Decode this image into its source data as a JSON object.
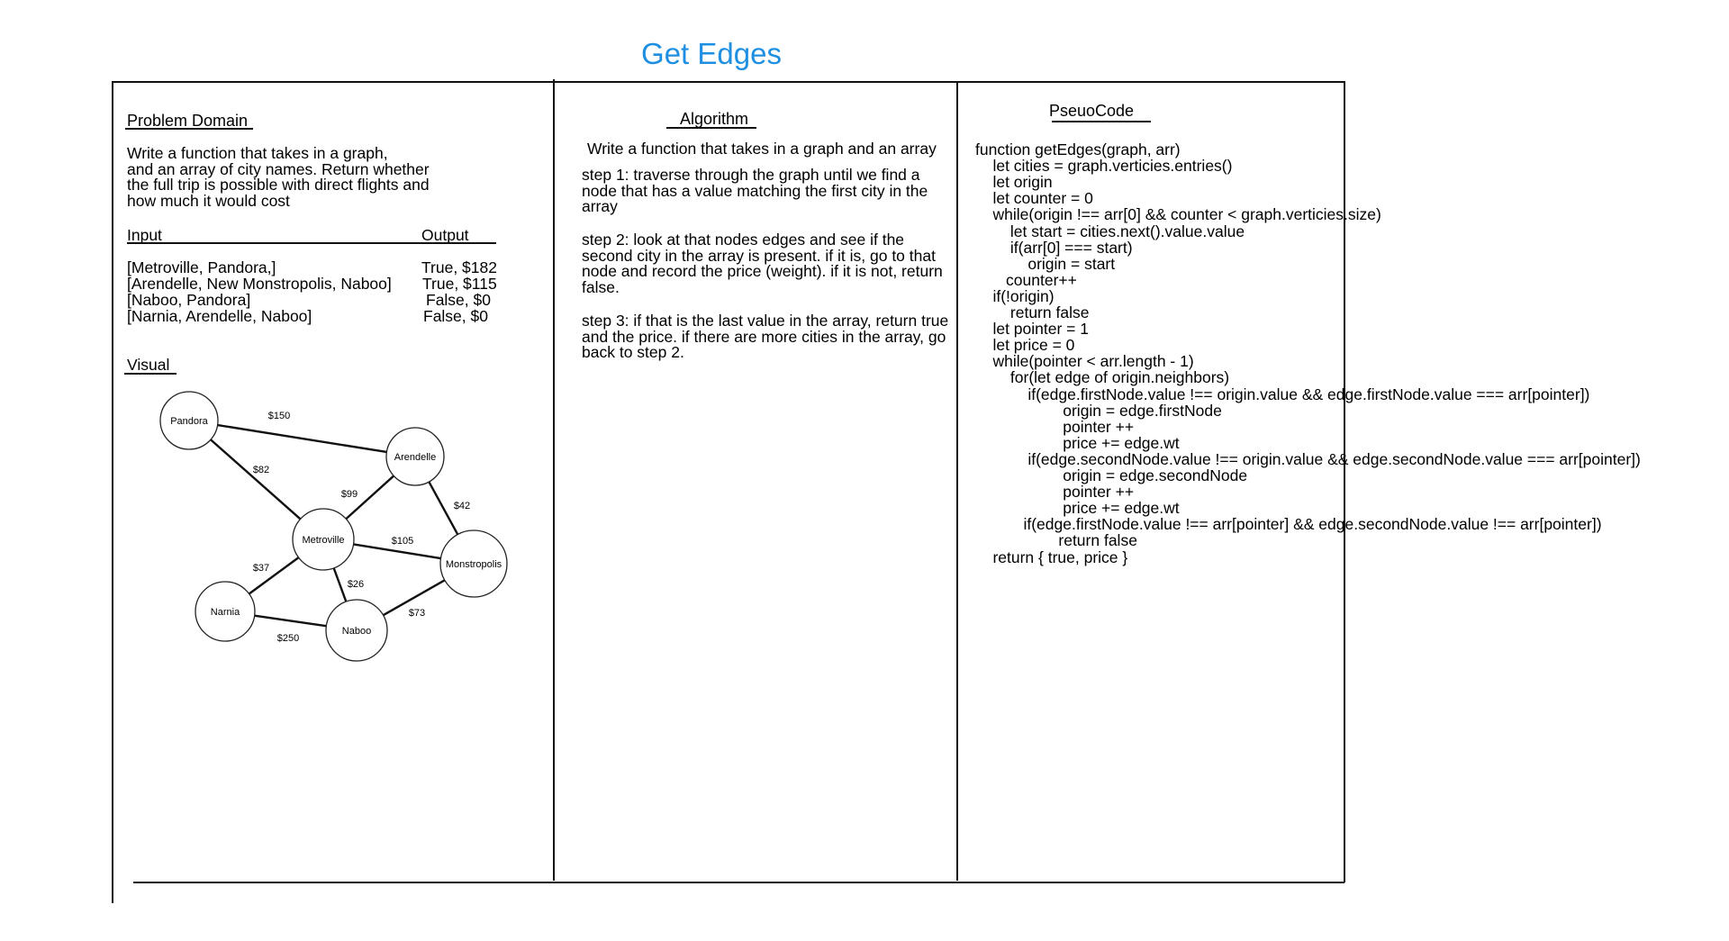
{
  "title": "Get Edges",
  "problem": {
    "heading": "Problem Domain",
    "description": [
      "Write a function that takes in a graph,",
      "and an array of city names. Return whether",
      "the full trip is possible with direct flights and",
      "how much it would cost"
    ],
    "input_header": "Input",
    "output_header": "Output",
    "rows": [
      {
        "input": "[Metroville, Pandora,]",
        "output": "True, $182"
      },
      {
        "input": "[Arendelle, New Monstropolis, Naboo]",
        "output": "True, $115"
      },
      {
        "input": "[Naboo, Pandora]",
        "output": "False, $0"
      },
      {
        "input": "[Narnia, Arendelle, Naboo]",
        "output": "False, $0"
      }
    ],
    "visual_heading": "Visual"
  },
  "graph": {
    "nodes": [
      {
        "name": "Pandora"
      },
      {
        "name": "Arendelle"
      },
      {
        "name": "Metroville"
      },
      {
        "name": "Monstropolis"
      },
      {
        "name": "Narnia"
      },
      {
        "name": "Naboo"
      }
    ],
    "edges": [
      {
        "from": "Pandora",
        "to": "Arendelle",
        "weight": "$150"
      },
      {
        "from": "Pandora",
        "to": "Metroville",
        "weight": "$82"
      },
      {
        "from": "Arendelle",
        "to": "Metroville",
        "weight": "$99"
      },
      {
        "from": "Arendelle",
        "to": "Monstropolis",
        "weight": "$42"
      },
      {
        "from": "Metroville",
        "to": "Monstropolis",
        "weight": "$105"
      },
      {
        "from": "Metroville",
        "to": "Narnia",
        "weight": "$37"
      },
      {
        "from": "Metroville",
        "to": "Naboo",
        "weight": "$26"
      },
      {
        "from": "Monstropolis",
        "to": "Naboo",
        "weight": "$73"
      },
      {
        "from": "Narnia",
        "to": "Naboo",
        "weight": "$250"
      }
    ]
  },
  "algorithm": {
    "heading": "Algorithm",
    "intro": "Write a function that takes in a graph and an array",
    "steps": [
      "step 1: traverse through the graph until we find a node that has a value matching the first city in the array",
      "step 2: look at that nodes edges and see if the second city in the array is present. if it is, go to that node and record the price (weight). if it is not, return false.",
      "step 3: if that is the last value in the array, return true and the price. if there are more cities in the array, go back to step 2."
    ]
  },
  "pseudocode": {
    "heading": "PseuoCode",
    "lines": [
      "function getEdges(graph, arr)",
      "    let cities = graph.verticies.entries()",
      "    let origin",
      "    let counter = 0",
      "    while(origin !== arr[0] && counter < graph.verticies.size)",
      "        let start = cities.next().value.value",
      "        if(arr[0] === start)",
      "            origin = start",
      "       counter++",
      "    if(!origin)",
      "        return false",
      "    let pointer = 1",
      "    let price = 0",
      "    while(pointer < arr.length - 1)",
      "        for(let edge of origin.neighbors)",
      "            if(edge.firstNode.value !== origin.value && edge.firstNode.value === arr[pointer])",
      "                    origin = edge.firstNode",
      "                    pointer ++",
      "                    price += edge.wt",
      "            if(edge.secondNode.value !== origin.value && edge.secondNode.value === arr[pointer])",
      "                    origin = edge.secondNode",
      "                    pointer ++",
      "                    price += edge.wt",
      "           if(edge.firstNode.value !== arr[pointer] && edge.secondNode.value !== arr[pointer])",
      "                   return false",
      "    return { true, price }"
    ]
  }
}
